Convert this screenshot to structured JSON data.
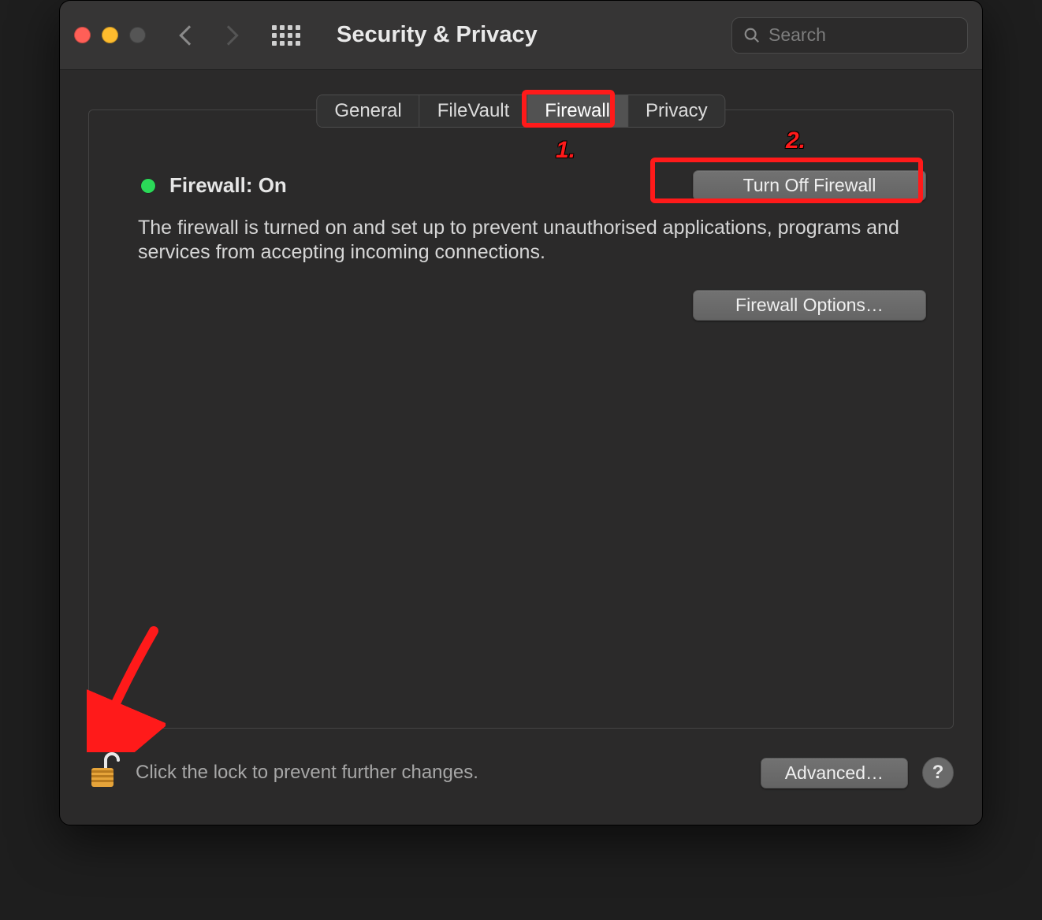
{
  "header": {
    "title": "Security & Privacy",
    "search_placeholder": "Search"
  },
  "tabs": {
    "general": "General",
    "filevault": "FileVault",
    "firewall": "Firewall",
    "privacy": "Privacy"
  },
  "firewall": {
    "status_label": "Firewall: On",
    "turn_off_label": "Turn Off Firewall",
    "description": "The firewall is turned on and set up to prevent unauthorised applications, programs and services from accepting incoming connections.",
    "options_label": "Firewall Options…"
  },
  "footer": {
    "lock_hint": "Click the lock to prevent further changes.",
    "advanced_label": "Advanced…",
    "help_label": "?"
  },
  "annotations": {
    "step1": "1.",
    "step2": "2."
  }
}
